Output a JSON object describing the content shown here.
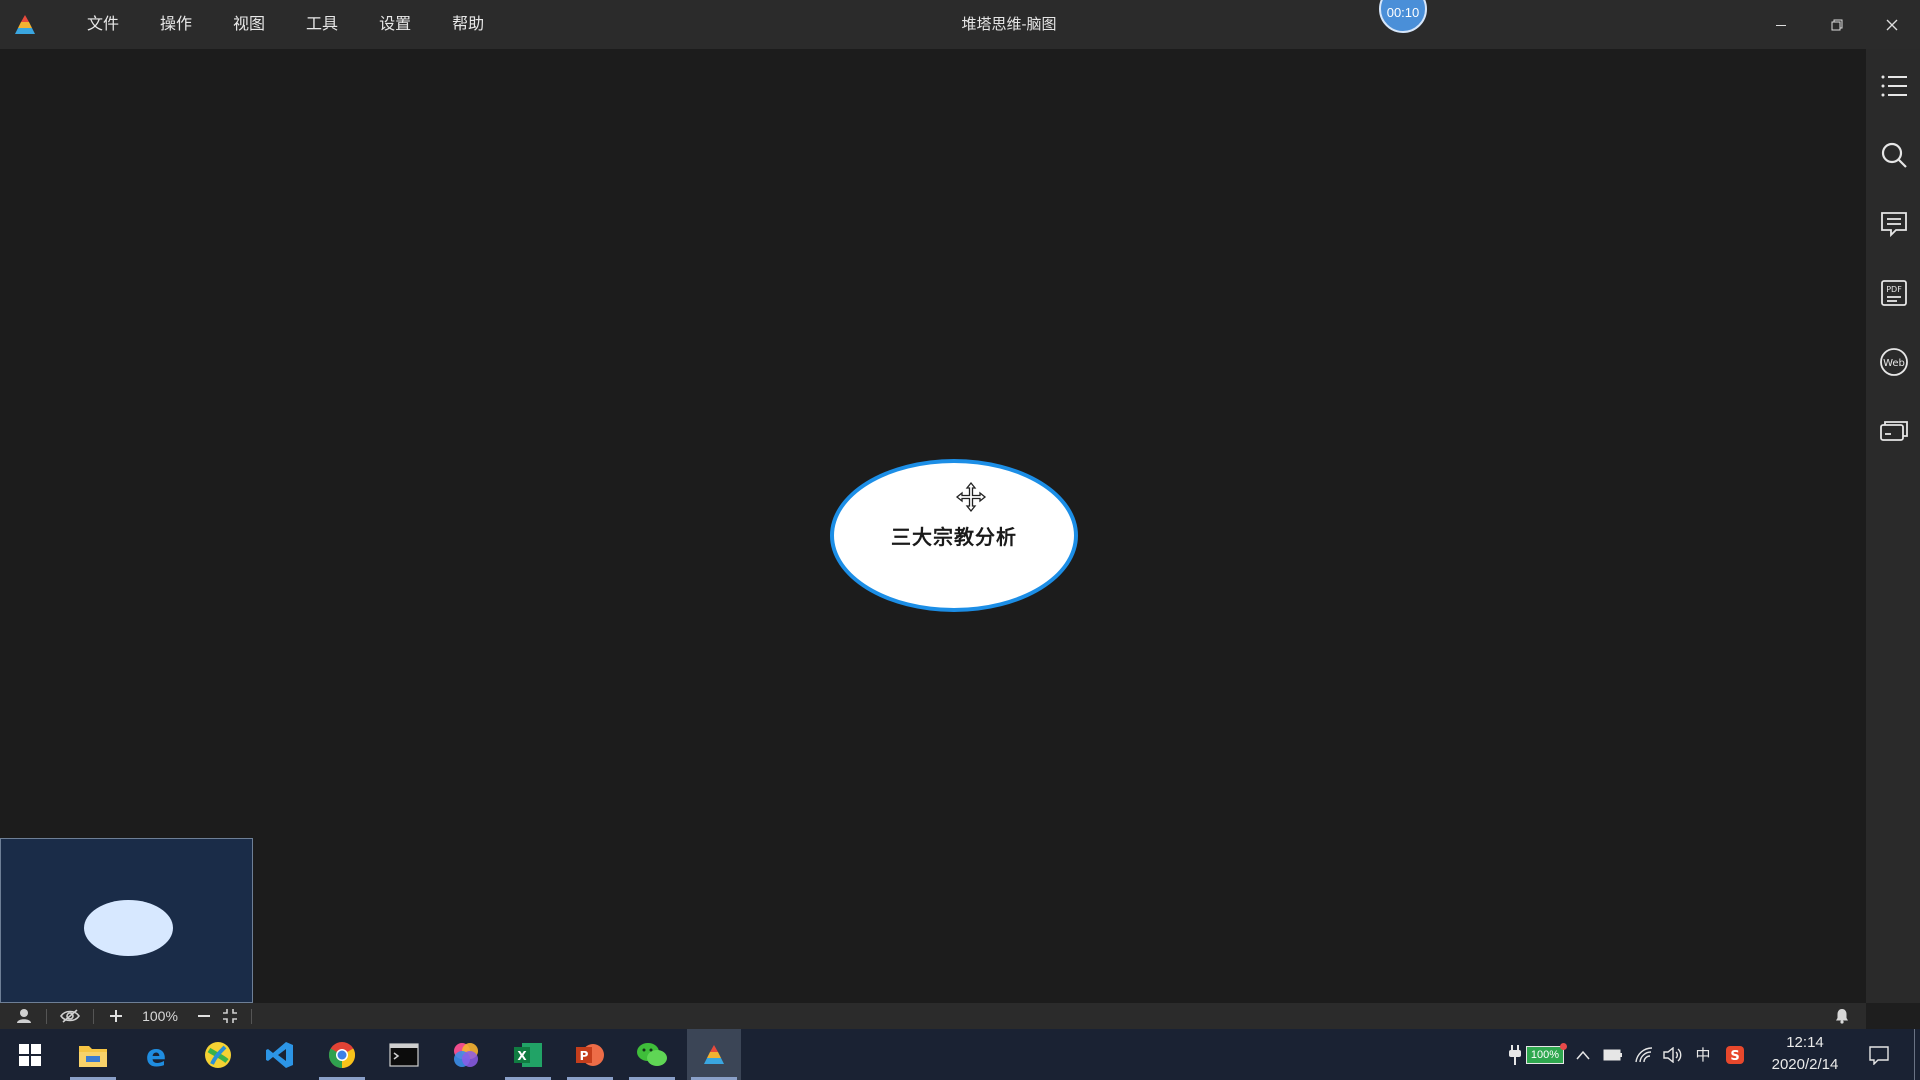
{
  "app": {
    "window_title": "堆塔思维-脑图",
    "timer": "00:10"
  },
  "menu": {
    "items": [
      "文件",
      "操作",
      "视图",
      "工具",
      "设置",
      "帮助"
    ]
  },
  "window_controls": [
    "minimize-icon",
    "restore-icon",
    "close-icon"
  ],
  "mindmap": {
    "central_topic": "三大宗教分析",
    "topic_fill": "#ffffff",
    "topic_border": "#1c8ee6"
  },
  "sidebar": {
    "tools": [
      "outline-icon",
      "search-icon",
      "notes-icon",
      "pdf-export-icon",
      "web-icon",
      "card-icon"
    ]
  },
  "minimap": {
    "background": "#1a2c48",
    "node_color": "#d7e8ff"
  },
  "statusbar": {
    "zoom": "100%"
  },
  "taskbar": {
    "apps": [
      "start-icon",
      "file-explorer-icon",
      "edge-icon",
      "qq-browser-icon",
      "vscode-icon",
      "chrome-icon",
      "terminal-icon",
      "color-app-icon",
      "excel-icon",
      "powerpoint-icon",
      "wechat-icon",
      "mindmap-app-icon"
    ],
    "battery": "100%",
    "ime": "中",
    "time": "12:14",
    "date": "2020/2/14"
  }
}
